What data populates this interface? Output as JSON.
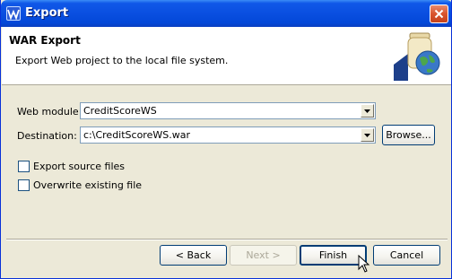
{
  "window": {
    "title": "Export",
    "app_icon": "wizard-icon",
    "close_icon": "close-icon"
  },
  "header": {
    "title": "WAR Export",
    "description": "Export Web project to the local file system.",
    "graphic": "export-jar-globe-icon"
  },
  "form": {
    "web_module_label": "Web module:",
    "web_module_value": "CreditScoreWS",
    "destination_label": "Destination:",
    "destination_value": "c:\\CreditScoreWS.war",
    "browse_label": "Browse...",
    "export_source_label": "Export source files",
    "export_source_checked": false,
    "overwrite_label": "Overwrite existing file",
    "overwrite_checked": false
  },
  "footer": {
    "back_label": "< Back",
    "next_label": "Next >",
    "finish_label": "Finish",
    "cancel_label": "Cancel"
  },
  "colors": {
    "titlebar": "#0a4fe0",
    "dialog_bg": "#ece9d8",
    "header_bg": "#ffffff",
    "input_border": "#7f9db9"
  }
}
